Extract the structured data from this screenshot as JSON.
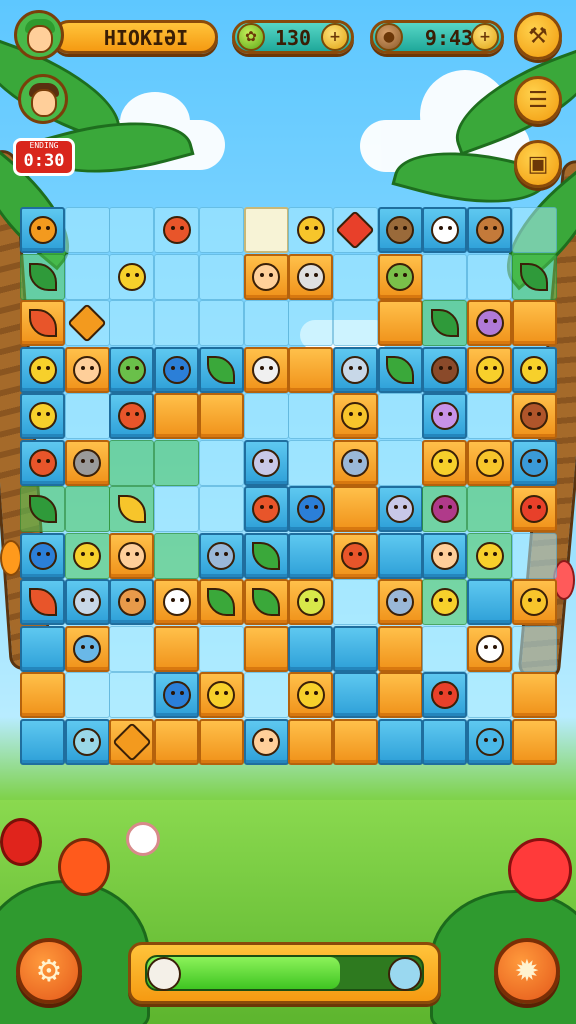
{
  "hud": {
    "player_name": "HIOKIƏI",
    "coins": "130",
    "moves": "9:43",
    "timer_label": "ENDING",
    "timer_value": "0:30"
  },
  "icons": {
    "coin": "leaf-coin-icon",
    "moves": "nut-icon",
    "settings": "wrench-icon",
    "menu": "list-icon",
    "shop": "shop-icon",
    "left_bottom": "gear-icon",
    "right_bottom": "star-gear-icon"
  },
  "colors": {
    "orange_tile": "#f0921a",
    "blue_tile": "#2ea0d8",
    "accent": "#8a4a0a",
    "progress": "#3fc522"
  },
  "progress": {
    "fraction": 0.7
  },
  "board": {
    "cols": 12,
    "rows": 13,
    "cells": [
      [
        "blue:#f39a1e",
        "light",
        "light",
        "light:#e8552a",
        "light",
        "cream",
        "light:#f7c52b",
        "light:#e8402a:star",
        "blue:#9a6a3a",
        "blue:#ffffff",
        "blue:#c47a3a",
        "light"
      ],
      [
        "green:#2f9a3a:leafy",
        "light",
        "light:#f7d02b",
        "light",
        "light",
        "orange:#ffd09a",
        "orange:#e0e0e0",
        "light",
        "orange:#7ac04a",
        "light",
        "light",
        "green:#2f9a3a:leafy"
      ],
      [
        "orange:#e8552a:leafy",
        "light:#f39a1e:star",
        "light",
        "light",
        "light",
        "light",
        "light",
        "light",
        "orange",
        "green:#2f9a3a:leafy",
        "orange:#b07ad8",
        "orange"
      ],
      [
        "blue:#f7d02b",
        "orange:#ffcf9a",
        "blue:#6ac04a",
        "blue:#2b7fd8",
        "blue:#3aa83a:leafy",
        "orange:#f0f0f0",
        "orange",
        "blue:#c8d8e8",
        "blue:#3aa83a:leafy",
        "blue:#8a4a2a",
        "orange:#f7d02b",
        "blue:#f7d02b"
      ],
      [
        "blue:#f7d02b",
        "light",
        "blue:#e8552a",
        "orange",
        "orange",
        "light",
        "light",
        "orange:#f7c52b",
        "light",
        "blue:#c892e8",
        "light",
        "orange:#b0552a"
      ],
      [
        "blue:#e8552a",
        "orange:#9a9a9a",
        "green",
        "green",
        "light",
        "blue:#c8c8e8",
        "light",
        "orange:#9ab8d8",
        "light",
        "orange:#f7d02b",
        "orange:#f7c52b",
        "blue:#3a9ad8"
      ],
      [
        "green:#2f9a3a:leafy",
        "green",
        "green:#f7c52b:leafy",
        "light",
        "light",
        "blue:#e8552a",
        "blue:#2b7fd8",
        "orange",
        "blue:#c8c8e8",
        "green:#b03a8a",
        "green",
        "orange:#e8402a"
      ],
      [
        "blue:#2b7fd8",
        "green:#f7d02b",
        "orange:#ffcf9a",
        "green",
        "blue:#9ab8d8",
        "blue:#3aa83a:leafy",
        "blue",
        "orange:#e8552a",
        "blue",
        "blue:#ffcf9a",
        "green:#f7d02b",
        "light"
      ],
      [
        "blue:#e8552a:leafy",
        "blue:#c8d8e8",
        "blue:#e89a4a",
        "orange:#ffffff",
        "orange:#3aa83a:leafy",
        "orange:#3aa83a:leafy",
        "orange:#d8e84a",
        "light",
        "orange:#9ab8d8",
        "green:#f7d02b",
        "blue",
        "orange:#f7c52b"
      ],
      [
        "blue",
        "orange:#6ab8e8",
        "light",
        "orange",
        "light",
        "orange",
        "blue",
        "blue",
        "orange",
        "light",
        "orange:#ffffff",
        "light"
      ],
      [
        "orange",
        "light",
        "light",
        "blue:#2b7fd8",
        "orange:#f7d02b",
        "light",
        "orange:#f7d02b",
        "blue",
        "orange",
        "blue:#e8402a",
        "light",
        "orange"
      ],
      [
        "blue",
        "blue:#9ad8e8",
        "orange:#f39a1e:star",
        "orange",
        "orange",
        "blue:#ffcf9a",
        "orange",
        "orange",
        "blue",
        "blue",
        "blue:#4ab8e8",
        "orange"
      ]
    ]
  }
}
